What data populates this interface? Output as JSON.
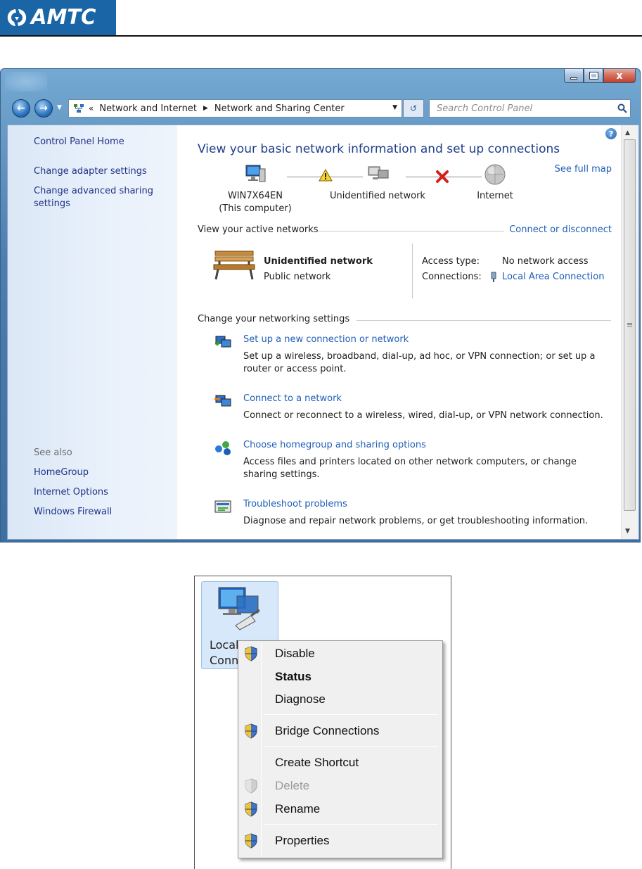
{
  "brand": {
    "name": "AMTC",
    "color": "#1a65a6"
  },
  "window": {
    "controls": {
      "minimize": "minimize-icon",
      "maximize": "maximize-icon",
      "close_label": "x"
    },
    "breadcrumb": {
      "overflow": "«",
      "items": [
        "Network and Internet",
        "Network and Sharing Center"
      ]
    },
    "search_placeholder": "Search Control Panel",
    "help_label": "?"
  },
  "sidebar": {
    "links": [
      "Control Panel Home",
      "Change adapter settings",
      "Change advanced sharing settings"
    ],
    "see_also_heading": "See also",
    "see_also": [
      "HomeGroup",
      "Internet Options",
      "Windows Firewall"
    ]
  },
  "main": {
    "title": "View your basic network information and set up connections",
    "see_full_map": "See full map",
    "map": {
      "computer_name": "WIN7X64EN",
      "computer_sub": "(This computer)",
      "network": "Unidentified network",
      "internet": "Internet",
      "link1_status": "warning",
      "link2_status": "disconnected"
    },
    "active_networks": {
      "heading": "View your active networks",
      "connect_link": "Connect or disconnect",
      "network_name": "Unidentified network",
      "network_category": "Public network",
      "access_type_label": "Access type:",
      "access_type_value": "No network access",
      "connections_label": "Connections:",
      "connections_value": "Local Area Connection"
    },
    "settings": {
      "heading": "Change your networking settings",
      "tasks": [
        {
          "title": "Set up a new connection or network",
          "desc": "Set up a wireless, broadband, dial-up, ad hoc, or VPN connection; or set up a router or access point."
        },
        {
          "title": "Connect to a network",
          "desc": "Connect or reconnect to a wireless, wired, dial-up, or VPN network connection."
        },
        {
          "title": "Choose homegroup and sharing options",
          "desc": "Access files and printers located on other network computers, or change sharing settings."
        },
        {
          "title": "Troubleshoot problems",
          "desc": "Diagnose and repair network problems, or get troubleshooting information."
        }
      ]
    }
  },
  "adapter": {
    "label_line1": "Local A",
    "label_line2": "Conn"
  },
  "context_menu": {
    "items": [
      {
        "label": "Disable",
        "shield": true
      },
      {
        "label": "Status",
        "default": true
      },
      {
        "label": "Diagnose"
      },
      {
        "label": "Bridge Connections",
        "shield": true
      },
      {
        "label": "Create Shortcut"
      },
      {
        "label": "Delete",
        "shield": true,
        "disabled": true
      },
      {
        "label": "Rename",
        "shield": true
      },
      {
        "label": "Properties",
        "shield": true
      }
    ]
  }
}
